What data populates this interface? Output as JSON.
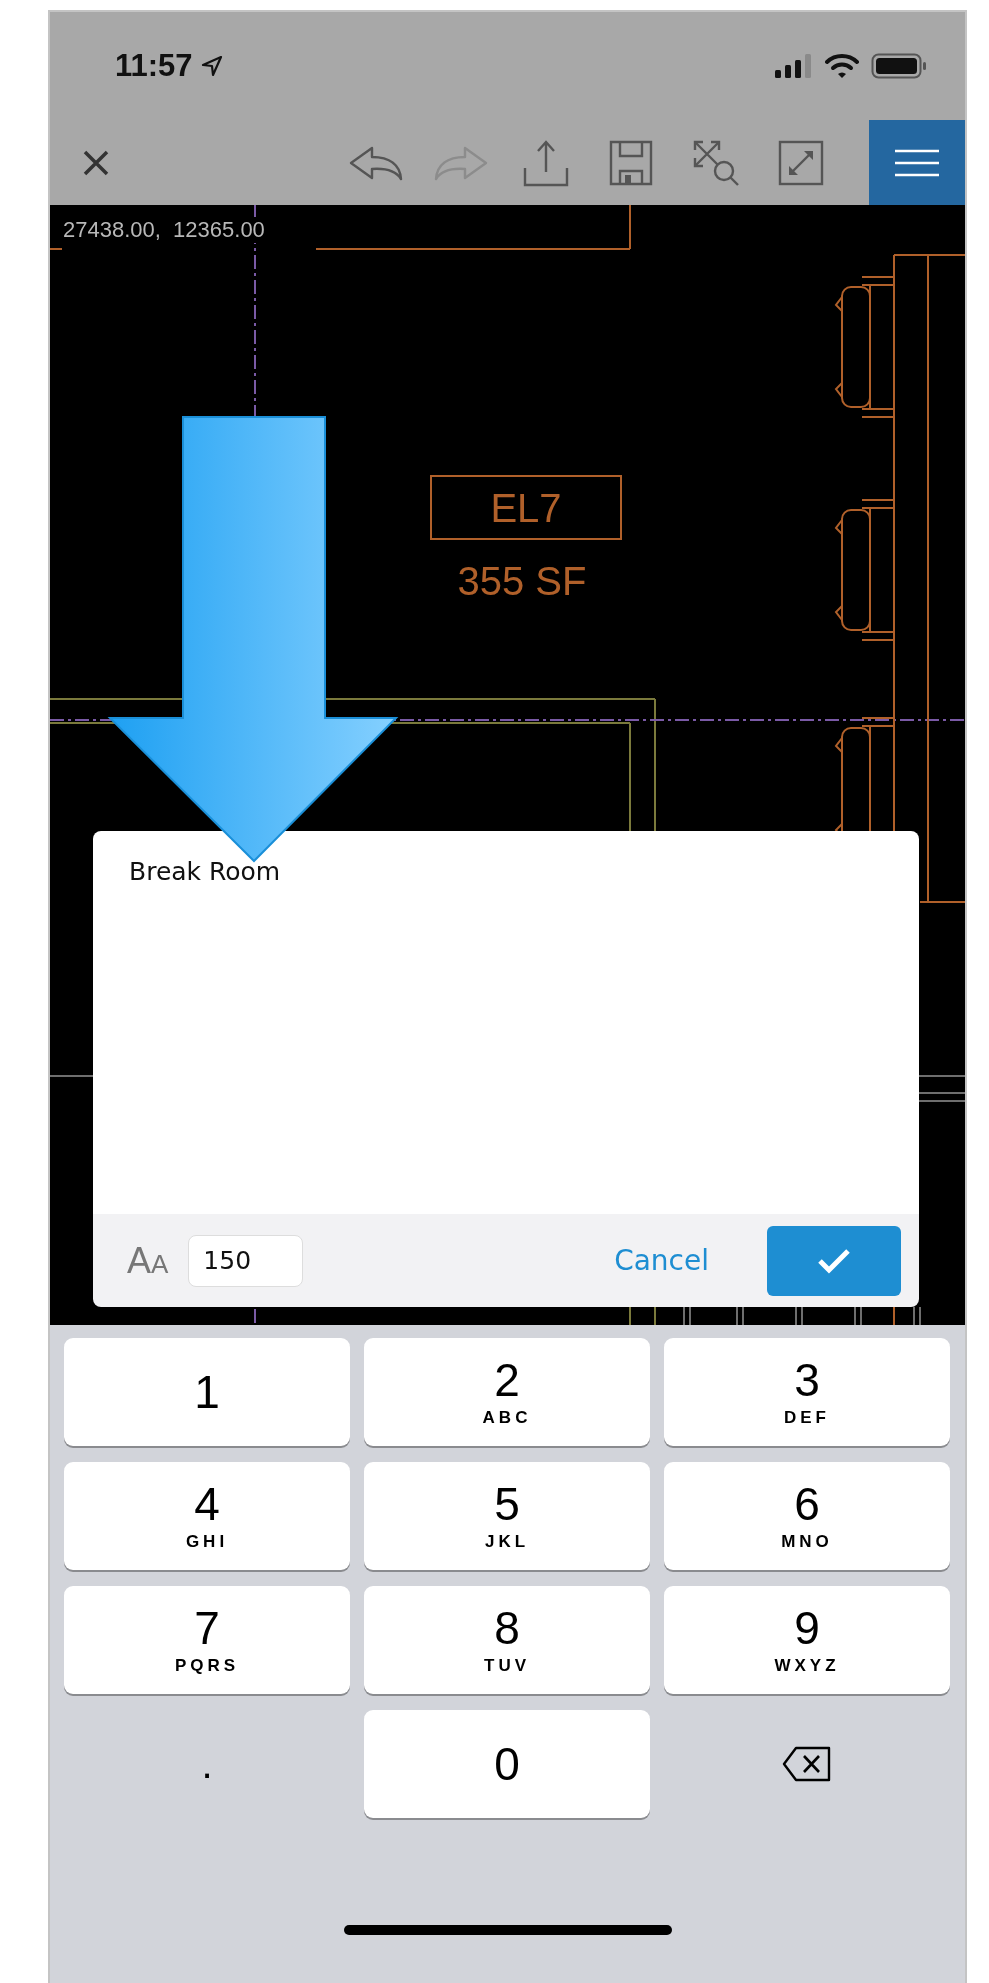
{
  "status_bar": {
    "time": "11:57"
  },
  "toolbar": {
    "buttons": [
      {
        "kind": "close",
        "disabled": false
      },
      {
        "kind": "undo",
        "disabled": false
      },
      {
        "kind": "redo",
        "disabled": true
      },
      {
        "kind": "share",
        "disabled": false
      },
      {
        "kind": "save",
        "disabled": false
      },
      {
        "kind": "zoom-extents",
        "disabled": false
      },
      {
        "kind": "fullscreen",
        "disabled": false
      },
      {
        "kind": "menu",
        "disabled": false
      }
    ]
  },
  "drawing": {
    "coordinates": "27438.00,  12365.00",
    "room_tag": "EL7",
    "area": "355 SF"
  },
  "text_dialog": {
    "value": "Break Room",
    "font_size_glyphs": [
      "A",
      "A"
    ],
    "font_size": "150",
    "cancel": "Cancel"
  },
  "keyboard": {
    "keys": [
      {
        "kind": "digit",
        "digit": "1"
      },
      {
        "kind": "digit",
        "digit": "2",
        "letters": "ABC"
      },
      {
        "kind": "digit",
        "digit": "3",
        "letters": "DEF"
      },
      {
        "kind": "digit",
        "digit": "4",
        "letters": "GHI"
      },
      {
        "kind": "digit",
        "digit": "5",
        "letters": "JKL"
      },
      {
        "kind": "digit",
        "digit": "6",
        "letters": "MNO"
      },
      {
        "kind": "digit",
        "digit": "7",
        "letters": "PQRS"
      },
      {
        "kind": "digit",
        "digit": "8",
        "letters": "TUV"
      },
      {
        "kind": "digit",
        "digit": "9",
        "letters": "WXYZ"
      },
      {
        "kind": "plain",
        "digit": "."
      },
      {
        "kind": "digit",
        "digit": "0"
      },
      {
        "kind": "backspace"
      }
    ]
  }
}
